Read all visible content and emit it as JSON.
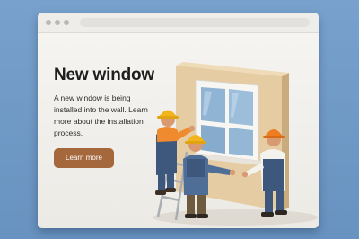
{
  "hero": {
    "title": "New window",
    "description": "A new window is being installed into the wall. Learn more about the installation process.",
    "cta_label": "Learn more"
  },
  "colors": {
    "background": "#6d98c4",
    "window_bg": "#f4f3f0",
    "button": "#a4683c",
    "wall": "#e2c9a0",
    "hard_hat_yellow": "#f2b51e",
    "hard_hat_orange": "#ee7d22",
    "overalls": "#3e587d"
  },
  "illustration": {
    "subject": "workers-installing-window",
    "workers": 3
  }
}
